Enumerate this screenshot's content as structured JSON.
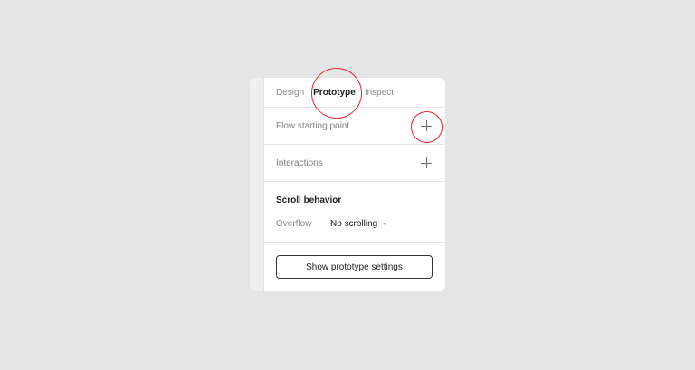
{
  "tabs": {
    "design": "Design",
    "prototype": "Prototype",
    "inspect": "Inspect",
    "active": "prototype"
  },
  "flow": {
    "label": "Flow starting point",
    "add_icon": "plus-icon"
  },
  "interactions": {
    "label": "Interactions",
    "add_icon": "plus-icon"
  },
  "scroll": {
    "title": "Scroll behavior",
    "overflow_label": "Overflow",
    "overflow_value": "No scrolling",
    "dropdown_icon": "chevron-down-icon"
  },
  "settings": {
    "button_label": "Show prototype settings"
  },
  "colors": {
    "annotation": "#e0232b",
    "background": "#e5e5e5",
    "panel": "#ffffff",
    "text_primary": "#1e1e1e",
    "text_secondary": "#8a8a8a"
  }
}
